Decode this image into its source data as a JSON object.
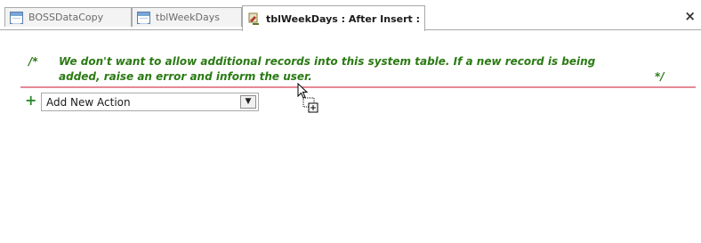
{
  "tabs": [
    {
      "label": "BOSSDataCopy",
      "icon": "form-icon"
    },
    {
      "label": "tblWeekDays",
      "icon": "table-icon"
    },
    {
      "label": "tblWeekDays : After Insert :",
      "icon": "macro-icon",
      "active": true
    }
  ],
  "close_label": "×",
  "comment": {
    "open": "/*",
    "text": "We don't want to allow additional records into this system table. If a new record is being added, raise an error and inform the user.",
    "close": "*/"
  },
  "add_action": {
    "plus": "+",
    "value": "Add New Action"
  },
  "colors": {
    "comment": "#2a7a13",
    "rule": "#e58a95",
    "plus": "#2e8b2e"
  }
}
